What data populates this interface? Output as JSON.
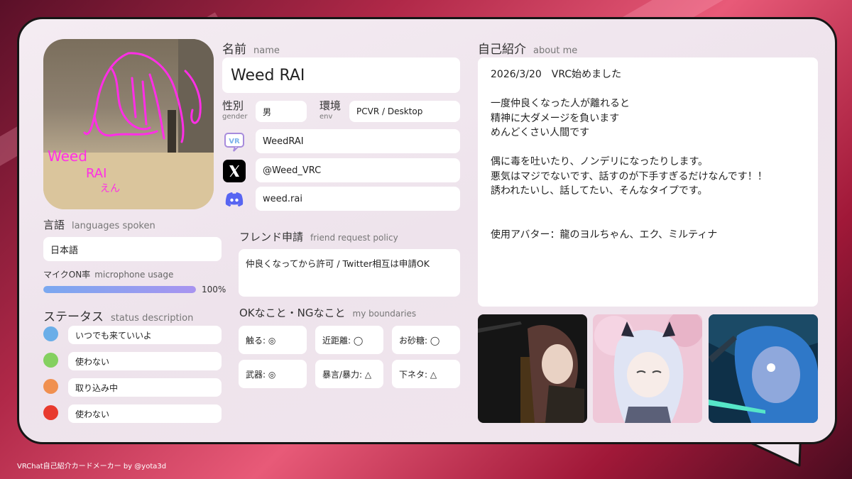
{
  "name_section": {
    "title": "名前",
    "title_en": "name",
    "value": "Weed RAI"
  },
  "gender": {
    "label": "性別",
    "label_en": "gender",
    "value": "男"
  },
  "env": {
    "label": "環境",
    "label_en": "env",
    "value": "PCVR / Desktop"
  },
  "accounts": [
    {
      "icon": "vrchat-icon",
      "value": "WeedRAI"
    },
    {
      "icon": "x-icon",
      "value": "@Weed_VRC"
    },
    {
      "icon": "discord-icon",
      "value": "weed.rai"
    }
  ],
  "avatar_scribble": {
    "line1": "Weed",
    "line2": "RAI",
    "line3": "えん"
  },
  "languages": {
    "title": "言語",
    "title_en": "languages spoken",
    "value": "日本語"
  },
  "mic": {
    "label": "マイクON率",
    "label_en": "microphone usage",
    "value_text": "100%",
    "percent": 100
  },
  "status": {
    "title": "ステータス",
    "title_en": "status description",
    "items": [
      {
        "color": "#6aaee8",
        "text": "いつでも来ていいよ"
      },
      {
        "color": "#84d060",
        "text": "使わない"
      },
      {
        "color": "#f09050",
        "text": "取り込み中"
      },
      {
        "color": "#e83a2e",
        "text": "使わない"
      }
    ]
  },
  "friend_request": {
    "title": "フレンド申請",
    "title_en": "friend request policy",
    "value": "仲良くなってから許可 / Twitter相互は申請OK"
  },
  "boundaries": {
    "title": "OKなこと・NGなこと",
    "title_en": "my boundaries",
    "items": [
      "触る: ◎",
      "近距離: ◯",
      "お砂糖: ◯",
      "武器: ◎",
      "暴言/暴力: △",
      "下ネタ: △"
    ]
  },
  "about": {
    "title": "自己紹介",
    "title_en": "about me",
    "lines": [
      "2026/3/20　VRC始めました",
      "",
      "一度仲良くなった人が離れると",
      "精神に大ダメージを負います",
      "めんどくさい人間です",
      "",
      "偶に毒を吐いたり、ノンデリになったりします。",
      "悪気はマジでないです、話すのが下手すぎるだけなんです！！",
      "誘われたいし、話してたい、そんなタイプです。",
      "",
      "",
      "使用アバター：龍のヨルちゃん、エク、ミルティナ"
    ]
  },
  "footer": "VRChat自己紹介カードメーカー by @yota3d"
}
